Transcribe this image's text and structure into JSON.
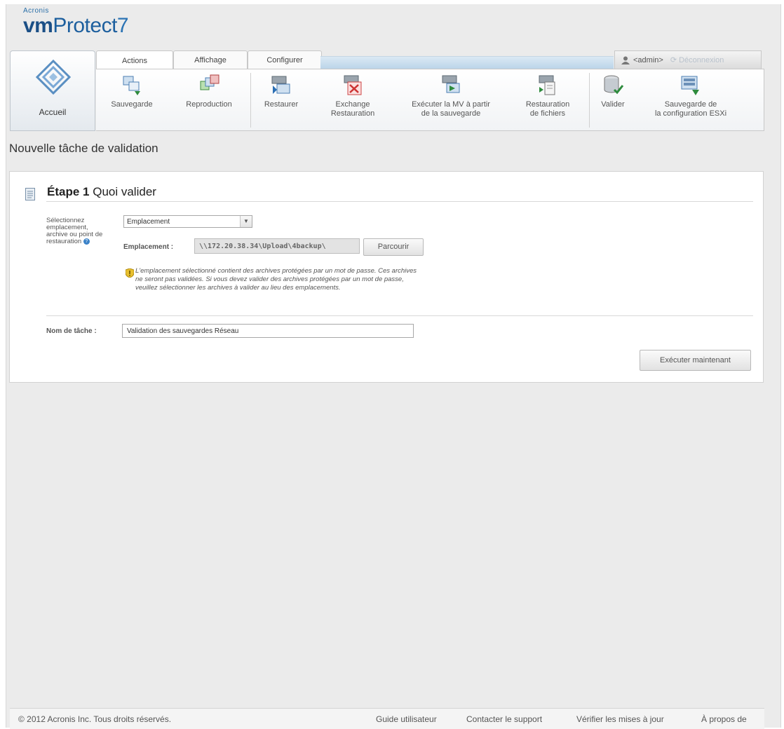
{
  "app": {
    "brand": "Acronis",
    "product_bold": "vm",
    "product_rest": "Protect",
    "version": "7"
  },
  "tabs": [
    "Actions",
    "Affichage",
    "Configurer"
  ],
  "user": {
    "name": "<admin>",
    "logout": "Déconnexion"
  },
  "home": {
    "label": "Accueil"
  },
  "toolbar": {
    "backup": "Sauvegarde",
    "replication": "Reproduction",
    "restore": "Restaurer",
    "exchange_line1": "Exchange",
    "exchange_line2": "Restauration",
    "run_vm_line1": "Exécuter la MV à partir",
    "run_vm_line2": "de la sauvegarde",
    "file_restore_line1": "Restauration",
    "file_restore_line2": "de fichiers",
    "validate": "Valider",
    "esx_backup_line1": "Sauvegarde de",
    "esx_backup_line2": "la configuration ESXi"
  },
  "page": {
    "title": "Nouvelle tâche de validation"
  },
  "step": {
    "number": "Étape 1",
    "title": "Quoi valider",
    "select_label_1": "Sélectionnez",
    "select_label_2": "emplacement,",
    "select_label_3": "archive ou point de",
    "select_label_4": "restauration",
    "select_value": "Emplacement",
    "location_label": "Emplacement :",
    "location_value": "\\\\172.20.38.34\\Upload\\4backup\\",
    "browse_label": "Parcourir",
    "warning_1": "L'emplacement sélectionné contient des archives protégées par un mot de passe. Ces archives",
    "warning_2": "ne seront pas validées. Si vous devez valider des archives protégées par un mot de passe,",
    "warning_3": "veuillez sélectionner les archives à valider au lieu des emplacements."
  },
  "task": {
    "label": "Nom de tâche :",
    "value": "Validation des sauvegardes Réseau"
  },
  "run_button": "Exécuter maintenant",
  "footer": {
    "copyright": "© 2012 Acronis Inc. Tous droits réservés.",
    "guide": "Guide utilisateur",
    "support": "Contacter le support",
    "updates": "Vérifier les mises à jour",
    "about": "À propos de"
  }
}
